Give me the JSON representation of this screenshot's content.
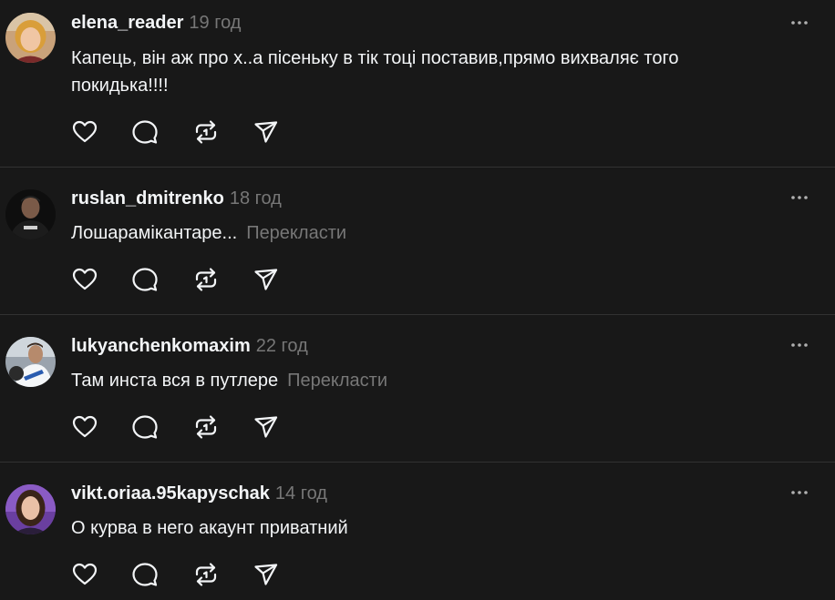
{
  "posts": [
    {
      "username": "elena_reader",
      "time": "19 год",
      "text": "Капець, він аж про х..а пісеньку в тік тоці поставив,прямо вихваляє того покидька!!!!",
      "translate": "",
      "avatar_icon": "woman-blonde-avatar"
    },
    {
      "username": "ruslan_dmitrenko",
      "time": "18 год",
      "text": "Лошарамікантаре...",
      "translate": "Перекласти",
      "avatar_icon": "man-black-shirt-avatar"
    },
    {
      "username": "lukyanchenkomaxim",
      "time": "22 год",
      "text": "Там инста вся в путлере",
      "translate": "Перекласти",
      "avatar_icon": "man-racing-avatar"
    },
    {
      "username": "vikt.oriaa.95kapyschak",
      "time": "14 год",
      "text": "О курва в него акаунт приватний",
      "translate": "",
      "avatar_icon": "woman-dark-hair-avatar"
    }
  ],
  "icons": {
    "more": "more-icon",
    "like": "heart-icon",
    "comment": "comment-icon",
    "repost": "repost-icon",
    "share": "share-icon"
  },
  "colors": {
    "background": "#181818",
    "text": "#f3f5f7",
    "muted": "#777777",
    "divider": "#323232"
  }
}
